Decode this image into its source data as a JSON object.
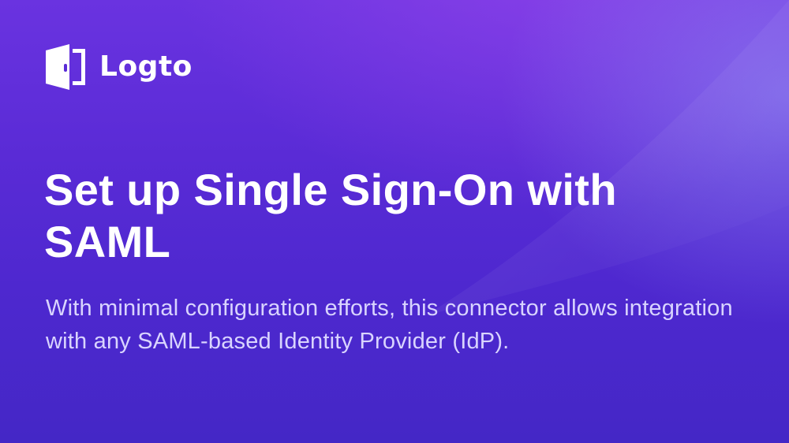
{
  "brand": {
    "name": "Logto",
    "logo_icon": "door-icon"
  },
  "hero": {
    "title": "Set up Single Sign-On with SAML",
    "subtitle": "With minimal configuration efforts, this connector allows integration with any SAML-based Identity Provider (IdP)."
  },
  "colors": {
    "background_top": "#6a33e0",
    "background_bottom": "#4427c6",
    "text_primary": "#ffffff",
    "text_secondary": "#d9d4ff"
  }
}
